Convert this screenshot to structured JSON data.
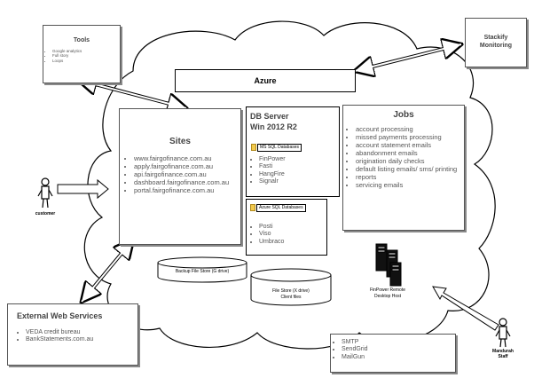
{
  "tools": {
    "title": "Tools",
    "items": [
      "Google analytics",
      "Full story",
      "Loops"
    ]
  },
  "stackify": {
    "line1": "Stackify",
    "line2": "Monitoring"
  },
  "azure": {
    "title": "Azure"
  },
  "sites": {
    "title": "Sites",
    "items": [
      "www.fairgofinance.com.au",
      "apply.fairgofinance.com.au",
      "api.fairgofinance.com.au",
      "dashboard.fairgofinance.com.au",
      "portal.fairgofinance.com.au"
    ]
  },
  "db_server": {
    "title_line1": "DB Server",
    "title_line2": "Win 2012 R2",
    "ms_sql_label": "MS SQL Databases",
    "ms_sql_items": [
      "FinPower",
      "Fasti",
      "HangFire",
      "Signalr"
    ],
    "azure_sql_label": "Azure SQL Databases",
    "azure_sql_items": [
      "Posti",
      "Viso",
      "Umbraco"
    ]
  },
  "jobs": {
    "title": "Jobs",
    "items": [
      "account processing",
      "missed payments processing",
      "account statement emails",
      "abandonment emails",
      "origination daily checks",
      "default listing emails/ sms/ printing",
      "reports",
      "servicing emails"
    ]
  },
  "customer": {
    "label": "customer"
  },
  "backup_store": {
    "label": "Backup File Store (G drive)"
  },
  "file_store": {
    "line1": "File Store (X drive)",
    "line2": "Client files"
  },
  "finpower_remote": {
    "line1": "FinPower Remote",
    "line2": "Desktop Host"
  },
  "external": {
    "title": "External Web Services",
    "items": [
      "VEDA credit bureau",
      "BankStatements.com.au"
    ]
  },
  "messaging": {
    "items": [
      "SMTP",
      "SendGrid",
      "MailGun"
    ]
  },
  "mandurah": {
    "line1": "Mandurah",
    "line2": "Staff"
  },
  "colors": {
    "folder": "#f2c94c",
    "border": "#555555"
  }
}
